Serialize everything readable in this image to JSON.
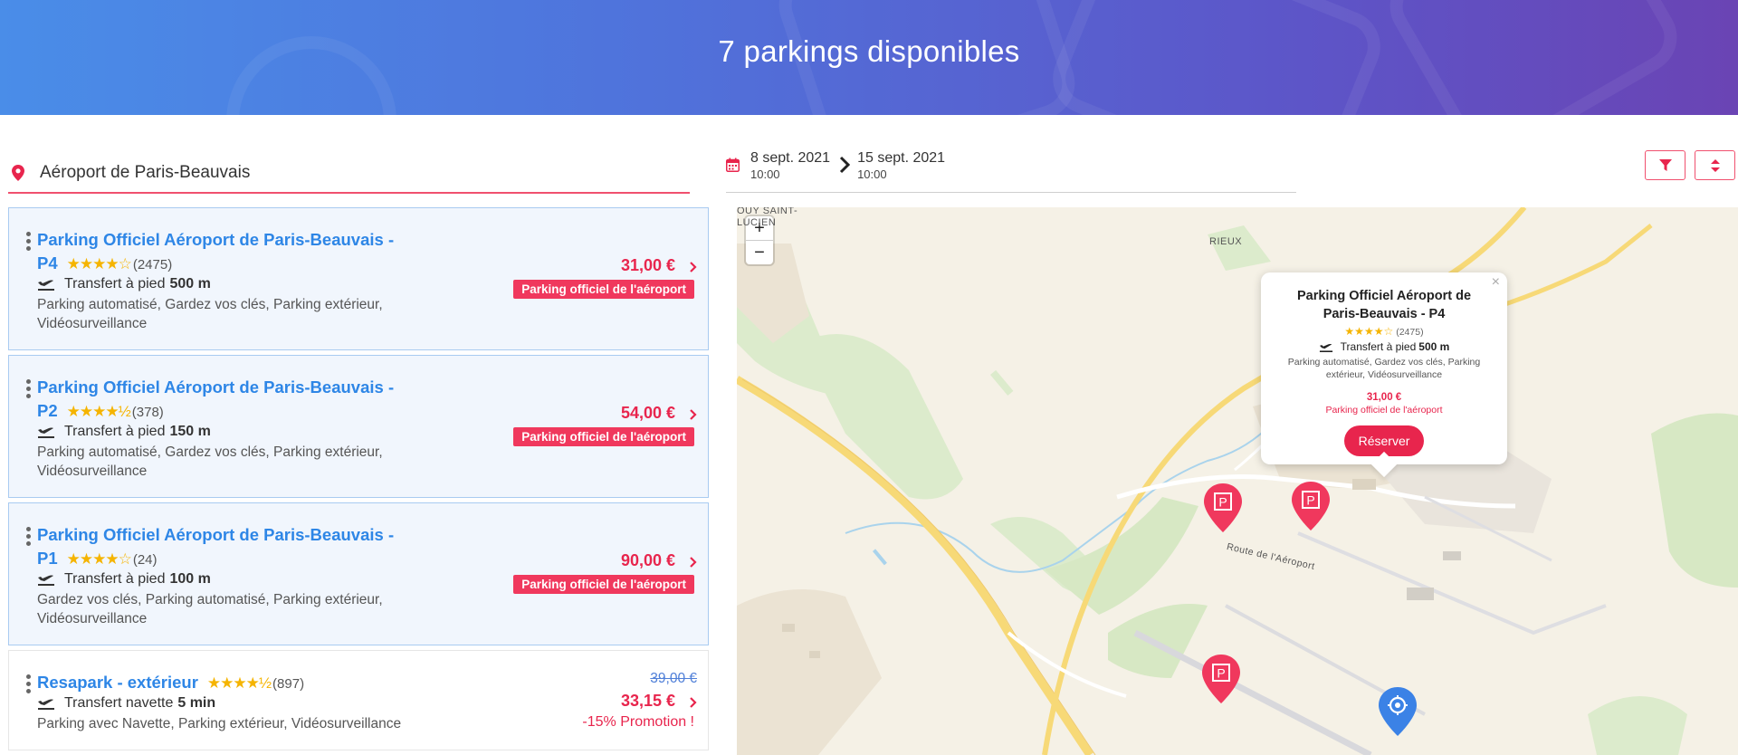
{
  "header": {
    "title": "7 parkings disponibles"
  },
  "search": {
    "location": "Aéroport de Paris-Beauvais",
    "start_date": "8 sept. 2021",
    "start_time": "10:00",
    "end_date": "15 sept. 2021",
    "end_time": "10:00"
  },
  "colors": {
    "accent": "#e8254d",
    "link": "#2e86e6",
    "highlight_bg": "#f1f6fd",
    "stars": "#f5b400"
  },
  "parkings": [
    {
      "title_line1": "Parking Officiel Aéroport de Paris-Beauvais -",
      "title_line2": "P4",
      "stars": "★★★★☆",
      "rating": 4,
      "reviews": "(2475)",
      "transfer_label": "Transfert à pied",
      "transfer_value": "500 m",
      "features_line1": "Parking automatisé, Gardez vos clés, Parking extérieur,",
      "features_line2": "Vidéosurveillance",
      "price": "31,00 €",
      "badge": "Parking officiel de l'aéroport"
    },
    {
      "title_line1": "Parking Officiel Aéroport de Paris-Beauvais -",
      "title_line2": "P2",
      "stars": "★★★★½",
      "rating": 4.5,
      "reviews": "(378)",
      "transfer_label": "Transfert à pied",
      "transfer_value": "150 m",
      "features_line1": "Parking automatisé, Gardez vos clés, Parking extérieur,",
      "features_line2": "Vidéosurveillance",
      "price": "54,00 €",
      "badge": "Parking officiel de l'aéroport"
    },
    {
      "title_line1": "Parking Officiel Aéroport de Paris-Beauvais -",
      "title_line2": "P1",
      "stars": "★★★★☆",
      "rating": 4,
      "reviews": "(24)",
      "transfer_label": "Transfert à pied",
      "transfer_value": "100 m",
      "features_line1": "Gardez vos clés, Parking automatisé, Parking extérieur,",
      "features_line2": "Vidéosurveillance",
      "price": "90,00 €",
      "badge": "Parking officiel de l'aéroport"
    },
    {
      "title_line1": "Resapark - extérieur",
      "stars": "★★★★½",
      "rating": 4.5,
      "reviews": "(897)",
      "transfer_label": "Transfert navette",
      "transfer_value": "5 min",
      "features_line1": "Parking avec Navette, Parking extérieur, Vidéosurveillance",
      "old_price": "39,00 €",
      "price": "33,15 €",
      "promo": "-15% Promotion !"
    }
  ],
  "map": {
    "zoom_in": "+",
    "zoom_out": "−",
    "labels": {
      "town_left": "OUY SAINT-",
      "town_left2": "LUCIEN",
      "town_right": "RIEUX",
      "road": "Route de l'Aéroport"
    },
    "popup": {
      "close": "×",
      "title": "Parking Officiel Aéroport de Paris-Beauvais - P4",
      "stars": "★★★★☆",
      "reviews": "(2475)",
      "transfer_label": "Transfert à pied",
      "transfer_value": "500 m",
      "features": "Parking automatisé, Gardez vos clés, Parking extérieur, Vidéosurveillance",
      "price": "31,00 €",
      "badge": "Parking officiel de l'aéroport",
      "reserve": "Réserver"
    },
    "marker_glyph": "P"
  }
}
